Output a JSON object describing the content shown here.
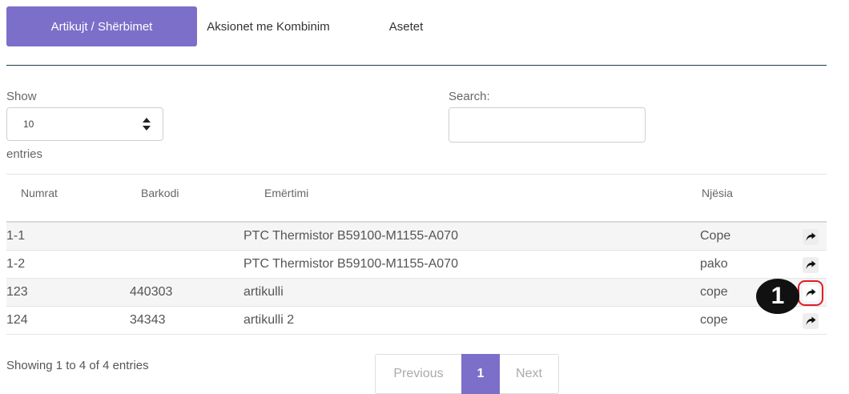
{
  "tabs": [
    {
      "label": "Artikujt / Shërbimet",
      "active": true
    },
    {
      "label": "Aksionet me Kombinim",
      "active": false
    },
    {
      "label": "Asetet",
      "active": false
    }
  ],
  "length": {
    "show_label": "Show",
    "value": "10",
    "entries_label": "entries"
  },
  "search": {
    "label": "Search:",
    "value": ""
  },
  "table": {
    "headers": [
      "Numrat",
      "Barkodi",
      "Emërtimi",
      "Njësia"
    ],
    "rows": [
      {
        "numrat": "1-1",
        "barkodi": "",
        "emertimi": "PTC Thermistor B59100-M1155-A070",
        "njesia": "Cope"
      },
      {
        "numrat": "1-2",
        "barkodi": "",
        "emertimi": "PTC Thermistor B59100-M1155-A070",
        "njesia": "pako"
      },
      {
        "numrat": "123",
        "barkodi": "440303",
        "emertimi": "artikulli",
        "njesia": "cope"
      },
      {
        "numrat": "124",
        "barkodi": "34343",
        "emertimi": "artikulli 2",
        "njesia": "cope"
      }
    ],
    "action_icon": "share-arrow-icon"
  },
  "annotation": {
    "number": "1",
    "color": "#e21c25"
  },
  "footer": {
    "info": "Showing 1 to 4 of 4 entries",
    "previous": "Previous",
    "current_page": "1",
    "next": "Next"
  },
  "colors": {
    "accent": "#7c6fc9",
    "highlight": "#e21c25"
  }
}
